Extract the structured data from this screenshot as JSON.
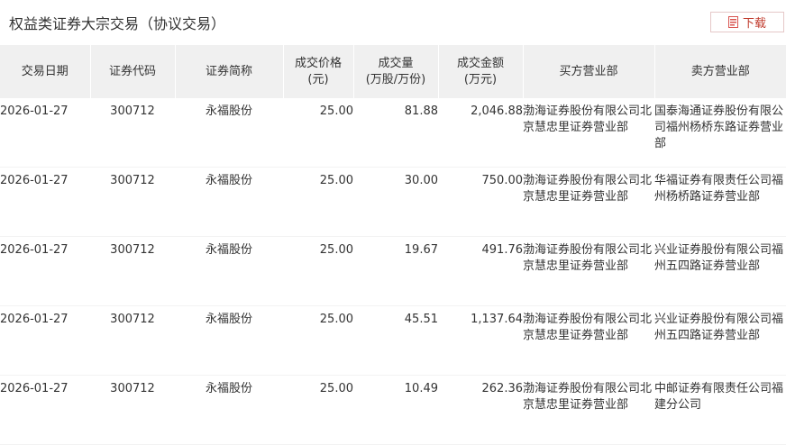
{
  "page": {
    "title": "权益类证券大宗交易（协议交易）",
    "download_label": "下载",
    "download_icon": "pdf-download-icon"
  },
  "table": {
    "columns": [
      {
        "line1": "交易日期",
        "line2": ""
      },
      {
        "line1": "证券代码",
        "line2": ""
      },
      {
        "line1": "证券简称",
        "line2": ""
      },
      {
        "line1": "成交价格",
        "line2": "(元)"
      },
      {
        "line1": "成交量",
        "line2": "(万股/万份)"
      },
      {
        "line1": "成交金额",
        "line2": "(万元)"
      },
      {
        "line1": "买方营业部",
        "line2": ""
      },
      {
        "line1": "卖方营业部",
        "line2": ""
      }
    ],
    "rows": [
      {
        "date": "2026-01-27",
        "code": "300712",
        "name": "永福股份",
        "price": "25.00",
        "volume": "81.88",
        "amount": "2,046.88",
        "buyer": "渤海证券股份有限公司北京慧忠里证券营业部",
        "seller": "国泰海通证券股份有限公司福州杨桥东路证券营业部"
      },
      {
        "date": "2026-01-27",
        "code": "300712",
        "name": "永福股份",
        "price": "25.00",
        "volume": "30.00",
        "amount": "750.00",
        "buyer": "渤海证券股份有限公司北京慧忠里证券营业部",
        "seller": "华福证券有限责任公司福州杨桥路证券营业部"
      },
      {
        "date": "2026-01-27",
        "code": "300712",
        "name": "永福股份",
        "price": "25.00",
        "volume": "19.67",
        "amount": "491.76",
        "buyer": "渤海证券股份有限公司北京慧忠里证券营业部",
        "seller": "兴业证券股份有限公司福州五四路证券营业部"
      },
      {
        "date": "2026-01-27",
        "code": "300712",
        "name": "永福股份",
        "price": "25.00",
        "volume": "45.51",
        "amount": "1,137.64",
        "buyer": "渤海证券股份有限公司北京慧忠里证券营业部",
        "seller": "兴业证券股份有限公司福州五四路证券营业部"
      },
      {
        "date": "2026-01-27",
        "code": "300712",
        "name": "永福股份",
        "price": "25.00",
        "volume": "10.49",
        "amount": "262.36",
        "buyer": "渤海证券股份有限公司北京慧忠里证券营业部",
        "seller": "中邮证券有限责任公司福建分公司"
      }
    ]
  },
  "colors": {
    "header_bg": "#f0f0f0",
    "download_text": "#c0392b",
    "download_border": "#e5c8c8"
  }
}
